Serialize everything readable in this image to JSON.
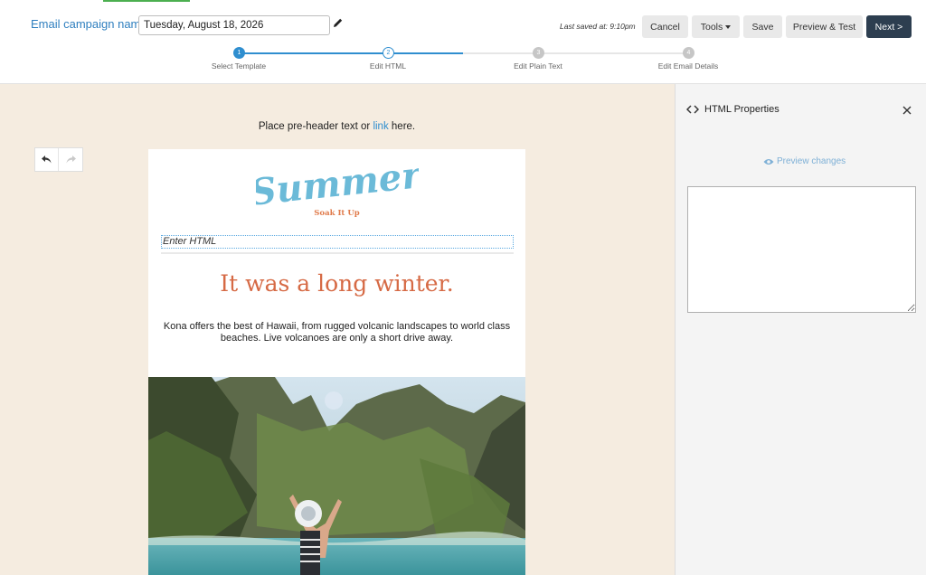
{
  "header": {
    "campaign_label": "Email campaign name:",
    "campaign_value": "Tuesday, August 18, 2026",
    "last_saved": "Last saved at: 9:10pm",
    "buttons": {
      "cancel": "Cancel",
      "tools": "Tools",
      "save": "Save",
      "preview_test": "Preview & Test",
      "next": "Next >"
    }
  },
  "stepper": {
    "steps": [
      {
        "number": "1",
        "label": "Select Template",
        "state": "complete"
      },
      {
        "number": "2",
        "label": "Edit HTML",
        "state": "current"
      },
      {
        "number": "3",
        "label": "Edit Plain Text",
        "state": "todo"
      },
      {
        "number": "4",
        "label": "Edit Email Details",
        "state": "todo"
      }
    ]
  },
  "canvas": {
    "preheader_before": "Place pre-header text or ",
    "preheader_link": "link",
    "preheader_after": " here.",
    "email": {
      "logo_text": "Summer",
      "logo_subtitle": "Soak It Up",
      "html_placeholder": "Enter HTML",
      "headline": "It was a long winter.",
      "body": "Kona offers the best of Hawaii, from rugged volcanic landscapes to world class beaches. Live volcanoes are only a short drive away."
    }
  },
  "panel": {
    "title": "HTML Properties",
    "preview_changes": "Preview changes",
    "textarea_value": ""
  },
  "colors": {
    "primary": "#2f8ecf",
    "next_button": "#2d3e50",
    "canvas_bg": "#f5ece0",
    "headline": "#d66a45",
    "logo": "#6bbad8"
  }
}
